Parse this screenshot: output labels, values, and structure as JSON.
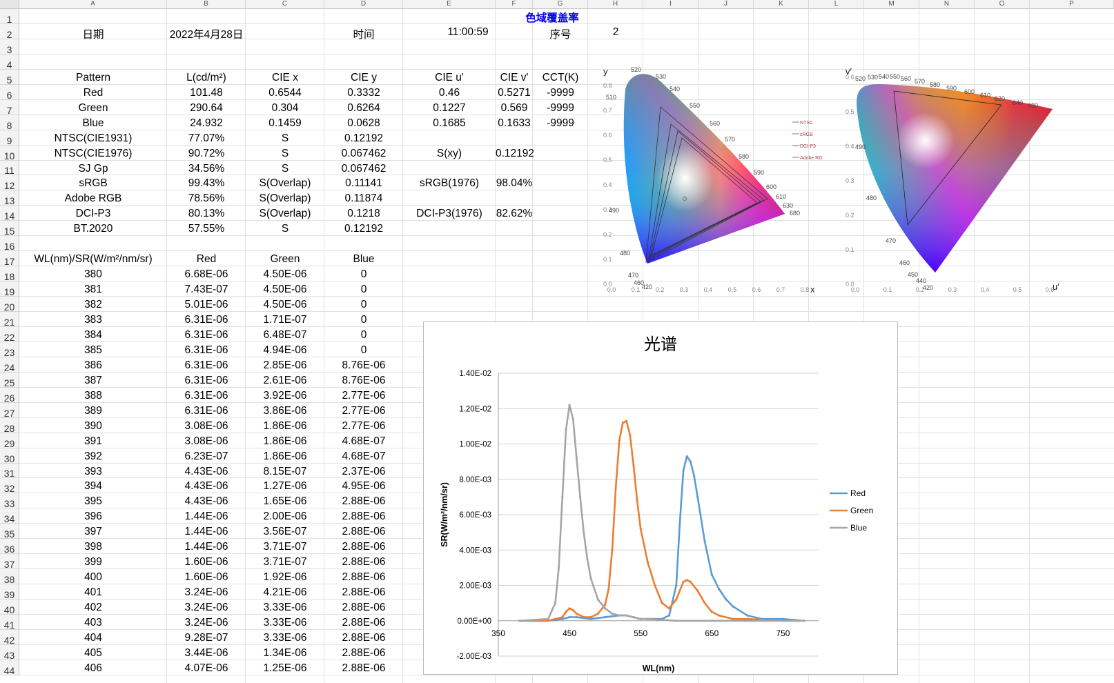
{
  "columns": [
    "A",
    "B",
    "C",
    "D",
    "E",
    "F",
    "G",
    "H",
    "I",
    "J",
    "K",
    "L",
    "M",
    "N",
    "O",
    "P"
  ],
  "row_numbers": [
    1,
    2,
    3,
    4,
    5,
    6,
    7,
    8,
    9,
    10,
    11,
    12,
    13,
    14,
    15,
    16,
    17,
    18,
    19,
    20,
    21,
    22,
    23,
    24,
    25,
    26,
    27,
    28,
    29,
    30,
    31,
    32,
    33,
    34,
    35,
    36,
    37,
    38,
    39,
    40,
    41,
    42,
    43,
    44
  ],
  "sheet_title": "色域覆盖率",
  "header_row": {
    "date_label": "日期",
    "date_value": "2022年4月28日",
    "time_label": "时间",
    "time_value": "11:00:59",
    "seq_label": "序号",
    "seq_value": "2"
  },
  "measure_headers": [
    "Pattern",
    "L(cd/m²)",
    "CIE x",
    "CIE y",
    "CIE u'",
    "CIE v'",
    "CCT(K)"
  ],
  "measure_rows": [
    [
      "Red",
      "101.48",
      "0.6544",
      "0.3332",
      "0.46",
      "0.5271",
      "-9999"
    ],
    [
      "Green",
      "290.64",
      "0.304",
      "0.6264",
      "0.1227",
      "0.569",
      "-9999"
    ],
    [
      "Blue",
      "24.932",
      "0.1459",
      "0.0628",
      "0.1685",
      "0.1633",
      "-9999"
    ]
  ],
  "gamut_rows": [
    [
      "NTSC(CIE1931)",
      "77.07%",
      "S",
      "0.12192",
      "",
      ""
    ],
    [
      "NTSC(CIE1976)",
      "90.72%",
      "S",
      "0.067462",
      "S(xy)",
      "0.12192"
    ],
    [
      "SJ Gp",
      "34.56%",
      "S",
      "0.067462",
      "",
      ""
    ],
    [
      "sRGB",
      "99.43%",
      "S(Overlap)",
      "0.11141",
      "sRGB(1976)",
      "98.04%"
    ],
    [
      "Adobe RGB",
      "78.56%",
      "S(Overlap)",
      "0.11874",
      "",
      ""
    ],
    [
      "DCI-P3",
      "80.13%",
      "S(Overlap)",
      "0.1218",
      "DCI-P3(1976)",
      "82.62%"
    ],
    [
      "BT.2020",
      "57.55%",
      "S",
      "0.12192",
      "",
      ""
    ]
  ],
  "spectrum_headers": [
    "WL(nm)/SR(W/m²/nm/sr)",
    "Red",
    "Green",
    "Blue"
  ],
  "spectrum_rows": [
    [
      "380",
      "6.68E-06",
      "4.50E-06",
      "0"
    ],
    [
      "381",
      "7.43E-07",
      "4.50E-06",
      "0"
    ],
    [
      "382",
      "5.01E-06",
      "4.50E-06",
      "0"
    ],
    [
      "383",
      "6.31E-06",
      "1.71E-07",
      "0"
    ],
    [
      "384",
      "6.31E-06",
      "6.48E-07",
      "0"
    ],
    [
      "385",
      "6.31E-06",
      "4.94E-06",
      "0"
    ],
    [
      "386",
      "6.31E-06",
      "2.85E-06",
      "8.76E-06"
    ],
    [
      "387",
      "6.31E-06",
      "2.61E-06",
      "8.76E-06"
    ],
    [
      "388",
      "6.31E-06",
      "3.92E-06",
      "2.77E-06"
    ],
    [
      "389",
      "6.31E-06",
      "3.86E-06",
      "2.77E-06"
    ],
    [
      "390",
      "3.08E-06",
      "1.86E-06",
      "2.77E-06"
    ],
    [
      "391",
      "3.08E-06",
      "1.86E-06",
      "4.68E-07"
    ],
    [
      "392",
      "6.23E-07",
      "1.86E-06",
      "4.68E-07"
    ],
    [
      "393",
      "4.43E-06",
      "8.15E-07",
      "2.37E-06"
    ],
    [
      "394",
      "4.43E-06",
      "1.27E-06",
      "4.95E-06"
    ],
    [
      "395",
      "4.43E-06",
      "1.65E-06",
      "2.88E-06"
    ],
    [
      "396",
      "1.44E-06",
      "2.00E-06",
      "2.88E-06"
    ],
    [
      "397",
      "1.44E-06",
      "3.56E-07",
      "2.88E-06"
    ],
    [
      "398",
      "1.44E-06",
      "3.71E-07",
      "2.88E-06"
    ],
    [
      "399",
      "1.60E-06",
      "3.71E-07",
      "2.88E-06"
    ],
    [
      "400",
      "1.60E-06",
      "1.92E-06",
      "2.88E-06"
    ],
    [
      "401",
      "3.24E-06",
      "4.21E-06",
      "2.88E-06"
    ],
    [
      "402",
      "3.24E-06",
      "3.33E-06",
      "2.88E-06"
    ],
    [
      "403",
      "3.24E-06",
      "3.33E-06",
      "2.88E-06"
    ],
    [
      "404",
      "9.28E-07",
      "3.33E-06",
      "2.88E-06"
    ],
    [
      "405",
      "3.44E-06",
      "1.34E-06",
      "2.88E-06"
    ],
    [
      "406",
      "4.07E-06",
      "1.25E-06",
      "2.88E-06"
    ]
  ],
  "cie1931": {
    "y_axis": "y",
    "x_axis": "x",
    "x_ticks": [
      "0.0",
      "0.1",
      "0.2",
      "0.3",
      "0.4",
      "0.5",
      "0.6",
      "0.7",
      "0.8"
    ],
    "y_ticks": [
      "0.0",
      "0.1",
      "0.2",
      "0.3",
      "0.4",
      "0.5",
      "0.6",
      "0.7",
      "0.8"
    ],
    "wavelengths": [
      "520",
      "530",
      "540",
      "550",
      "560",
      "570",
      "580",
      "590",
      "600",
      "610",
      "630",
      "680",
      "510",
      "490",
      "480",
      "470",
      "460",
      "420"
    ],
    "legend": [
      "NTSC",
      "sRGB",
      "DCI-P3",
      "Adobe RGB"
    ]
  },
  "cie1976": {
    "y_axis": "v′",
    "x_axis": "u′",
    "x_ticks": [
      "0.0",
      "0.1",
      "0.2",
      "0.3",
      "0.4",
      "0.5",
      "0.6"
    ],
    "y_ticks": [
      "0.0",
      "0.1",
      "0.2",
      "0.3",
      "0.4",
      "0.5",
      "0.6"
    ],
    "wavelengths": [
      "520",
      "530",
      "540",
      "550",
      "560",
      "570",
      "580",
      "590",
      "600",
      "610",
      "620",
      "640",
      "680",
      "490",
      "480",
      "470",
      "460",
      "450",
      "440",
      "420"
    ]
  },
  "chart_data": {
    "type": "line",
    "title": "光谱",
    "xlabel": "WL(nm)",
    "ylabel": "SR(W/m²/nm/sr)",
    "xlim": [
      350,
      800
    ],
    "ylim": [
      -0.002,
      0.014
    ],
    "x_ticks": [
      "350",
      "450",
      "550",
      "650",
      "750"
    ],
    "y_ticks": [
      "-2.00E-03",
      "0.00E+00",
      "2.00E-03",
      "4.00E-03",
      "6.00E-03",
      "8.00E-03",
      "1.00E-02",
      "1.20E-02",
      "1.40E-02"
    ],
    "legend_position": "right",
    "series": [
      {
        "name": "Red",
        "color": "#5b9bd5",
        "x": [
          380,
          420,
          440,
          450,
          460,
          480,
          500,
          520,
          530,
          540,
          550,
          560,
          580,
          590,
          600,
          605,
          610,
          615,
          620,
          625,
          630,
          640,
          650,
          660,
          670,
          680,
          700,
          720,
          750,
          780
        ],
        "y": [
          0,
          0,
          0.0001,
          0.0002,
          0.0002,
          0.0001,
          0.0002,
          0.0003,
          0.0003,
          0.0002,
          0.0001,
          0.0001,
          0.0001,
          0.0003,
          0.002,
          0.0055,
          0.0085,
          0.0093,
          0.009,
          0.0082,
          0.007,
          0.0045,
          0.0026,
          0.0018,
          0.0012,
          0.0008,
          0.0003,
          0.0001,
          0.0001,
          0
        ]
      },
      {
        "name": "Green",
        "color": "#ed7d31",
        "x": [
          380,
          420,
          440,
          445,
          450,
          455,
          460,
          470,
          480,
          490,
          500,
          505,
          510,
          515,
          520,
          525,
          530,
          535,
          540,
          545,
          550,
          560,
          570,
          580,
          590,
          600,
          610,
          615,
          620,
          630,
          640,
          650,
          660,
          680,
          700,
          750,
          780
        ],
        "y": [
          0,
          0,
          0.0002,
          0.0005,
          0.0007,
          0.0006,
          0.0004,
          0.0002,
          0.0002,
          0.0004,
          0.0009,
          0.0018,
          0.004,
          0.0075,
          0.0102,
          0.0112,
          0.0113,
          0.0105,
          0.0088,
          0.0068,
          0.0052,
          0.0033,
          0.002,
          0.001,
          0.0007,
          0.0012,
          0.0022,
          0.0023,
          0.0022,
          0.0017,
          0.001,
          0.0005,
          0.0003,
          0.0001,
          0.0001,
          0,
          0
        ]
      },
      {
        "name": "Blue",
        "color": "#a5a5a5",
        "x": [
          380,
          420,
          430,
          435,
          440,
          445,
          450,
          455,
          460,
          465,
          470,
          475,
          480,
          490,
          500,
          510,
          520,
          530,
          540,
          550,
          560,
          600,
          650,
          700,
          780
        ],
        "y": [
          0,
          0.0001,
          0.001,
          0.003,
          0.007,
          0.0108,
          0.0122,
          0.0114,
          0.0092,
          0.007,
          0.005,
          0.0035,
          0.0024,
          0.0012,
          0.0007,
          0.0004,
          0.0003,
          0.0003,
          0.0002,
          0.0001,
          0.0001,
          0,
          0,
          0,
          0
        ]
      }
    ]
  }
}
